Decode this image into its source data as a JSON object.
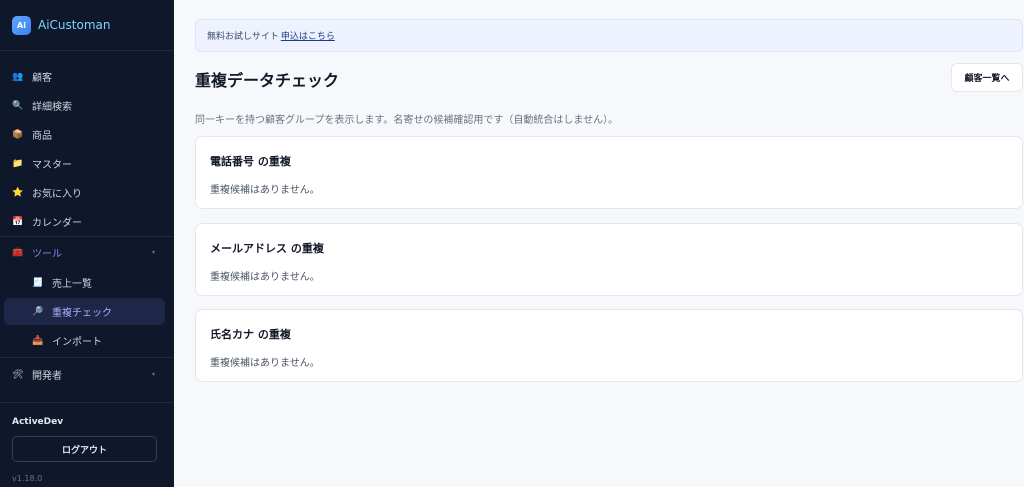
{
  "app": {
    "logo_text": "Ai",
    "name": "AiCustoman"
  },
  "sidebar": {
    "items": [
      {
        "icon": "users-icon",
        "glyph": "👥",
        "label": "顧客"
      },
      {
        "icon": "search-icon",
        "glyph": "🔍",
        "label": "詳細検索"
      },
      {
        "icon": "box-icon",
        "glyph": "📦",
        "label": "商品"
      },
      {
        "icon": "folder-icon",
        "glyph": "📁",
        "label": "マスター"
      },
      {
        "icon": "star-icon",
        "glyph": "⭐",
        "label": "お気に入り"
      },
      {
        "icon": "calendar-icon",
        "glyph": "📅",
        "label": "カレンダー"
      },
      {
        "icon": "toolbox-icon",
        "glyph": "🧰",
        "label": "ツール",
        "expanded": true
      },
      {
        "icon": "sales-icon",
        "glyph": "🧾",
        "label": "売上一覧"
      },
      {
        "icon": "magnifier-icon",
        "glyph": "🔎",
        "label": "重複チェック",
        "active": true
      },
      {
        "icon": "import-icon",
        "glyph": "📥",
        "label": "インポート"
      },
      {
        "icon": "tools-icon",
        "glyph": "🛠",
        "label": "開発者"
      }
    ],
    "user_name": "ActiveDev",
    "logout_label": "ログアウト",
    "version": "v1.18.0"
  },
  "banner": {
    "text": "無料お試しサイト",
    "link": "申込はこちら"
  },
  "page": {
    "title": "重複データチェック",
    "back_button": "顧客一覧へ",
    "description": "同一キーを持つ顧客グループを表示します。名寄せの候補確認用です（自動統合はしません）。"
  },
  "sections": [
    {
      "title": "電話番号 の重複",
      "message": "重複候補はありません。"
    },
    {
      "title": "メールアドレス の重複",
      "message": "重複候補はありません。"
    },
    {
      "title": "氏名カナ の重複",
      "message": "重複候補はありません。"
    }
  ],
  "colors": {
    "sidebar_bg": "#0f172a",
    "accent": "#818cf8",
    "brand": "#7dd3fc"
  }
}
